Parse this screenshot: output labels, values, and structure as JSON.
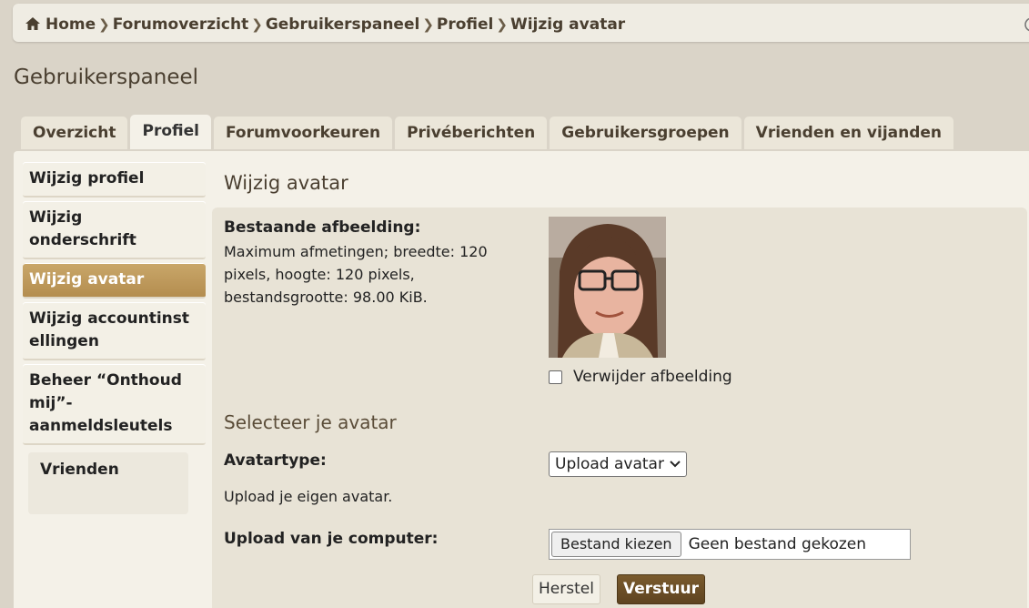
{
  "breadcrumbs": [
    "Home",
    "Forumoverzicht",
    "Gebruikerspaneel",
    "Profiel",
    "Wijzig avatar"
  ],
  "panel_title": "Gebruikerspaneel",
  "tabs": [
    "Overzicht",
    "Profiel",
    "Forumvoorkeuren",
    "Privéberichten",
    "Gebruikersgroepen",
    "Vrienden en vijanden"
  ],
  "active_tab": "Profiel",
  "sidebar": {
    "items": [
      {
        "label": "Wijzig profiel"
      },
      {
        "label": "Wijzig onderschrift"
      },
      {
        "label": "Wijzig avatar"
      },
      {
        "label": "Wijzig accountinstellingen"
      },
      {
        "label": "Beheer “Onthoud mij”-aanmeldsleutels"
      }
    ],
    "box_label": "Vrienden"
  },
  "main": {
    "title": "Wijzig avatar",
    "existing_label": "Bestaande afbeelding:",
    "existing_desc": "Maximum afmetingen; breedte: 120 pixels, hoogte: 120 pixels, bestandsgrootte: 98.00 KiB.",
    "remove_label": "Verwijder afbeelding",
    "select_title": "Selecteer je avatar",
    "avatartype_label": "Avatartype:",
    "avatartype_value": "Upload avatar",
    "upload_hint": "Upload je eigen avatar.",
    "upload_label": "Upload van je computer:",
    "file_button": "Bestand kiezen",
    "file_status": "Geen bestand gekozen",
    "reset_button": "Herstel",
    "submit_button": "Verstuur"
  },
  "colors": {
    "accent": "#b48d4f",
    "submit": "#6b4e26",
    "background": "#dad4c8"
  }
}
